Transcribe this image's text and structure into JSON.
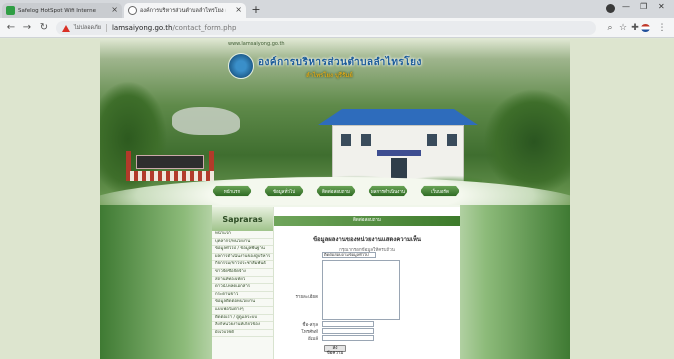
{
  "browser": {
    "tabs": [
      {
        "title": "Safelog HotSpot Wifi Interne",
        "state": "inactive"
      },
      {
        "title": "องค์การบริหารส่วนตำบลลำไทรโยง ลำไทรโยง",
        "state": "active"
      }
    ],
    "new_tab_symbol": "+",
    "address": {
      "security_label": "ไม่ปลอดภัย",
      "host": "lamsaiyong.go.th",
      "path": "/contact_form.php"
    }
  },
  "site": {
    "url_text": "www.lamsaiyong.go.th",
    "title": "องค์การบริหารส่วนตำบลลำไทรโยง",
    "subtitle": "ลำไทรโยง บุรีรัมย์",
    "menu": [
      "หน้าแรก",
      "ข้อมูลทั่วไป",
      "ติดต่อสอบถาม",
      "ผลการดำเนินงาน",
      "เว็บบอร์ด"
    ],
    "sidebar": {
      "heading": "Sapraras",
      "items": [
        "หน้าแรก",
        "บุคลากร/หน่วยงาน",
        "ข้อมูลทั่วไป / ข้อมูลพื้นฐาน",
        "ผลการดำเนินงานของผู้บริหาร",
        "กิจกรรม/ข่าวประชาสัมพันธ์",
        "ข่าวจัดซื้อจัดจ้าง",
        "สถานที่ท่องเที่ยว",
        "ดาวน์โหลดเอกสาร",
        "กระดานข่าว",
        "ข้อมูลติดต่อหน่วยงาน",
        "แบบฟอร์มต่างๆ",
        "ติดต่อเรา / ผู้ดูแลระบบ",
        "ลิงก์หน่วยงานที่เกี่ยวข้อง",
        "ผังเว็บไซต์"
      ]
    },
    "contact_form": {
      "header": "ติดต่อสอบถาม",
      "title": "ข้อมูลผลงานของหน่วยงานแสดงความเห็น",
      "hint": "กรุณากรอกข้อมูลให้ครบถ้วน",
      "subject_value": "ติดต่อสอบถามข้อมูลทั่วไป",
      "message_label": "รายละเอียด",
      "name_label": "ชื่อ-สกุล",
      "phone_label": "โทรศัพท์",
      "email_label": "อีเมล์",
      "submit_label": "ส่งข้อความ"
    }
  },
  "colors": {
    "accent_green": "#3d7a2b",
    "title_blue": "#1c5c9a",
    "subtitle_gold": "#d8a41a"
  }
}
